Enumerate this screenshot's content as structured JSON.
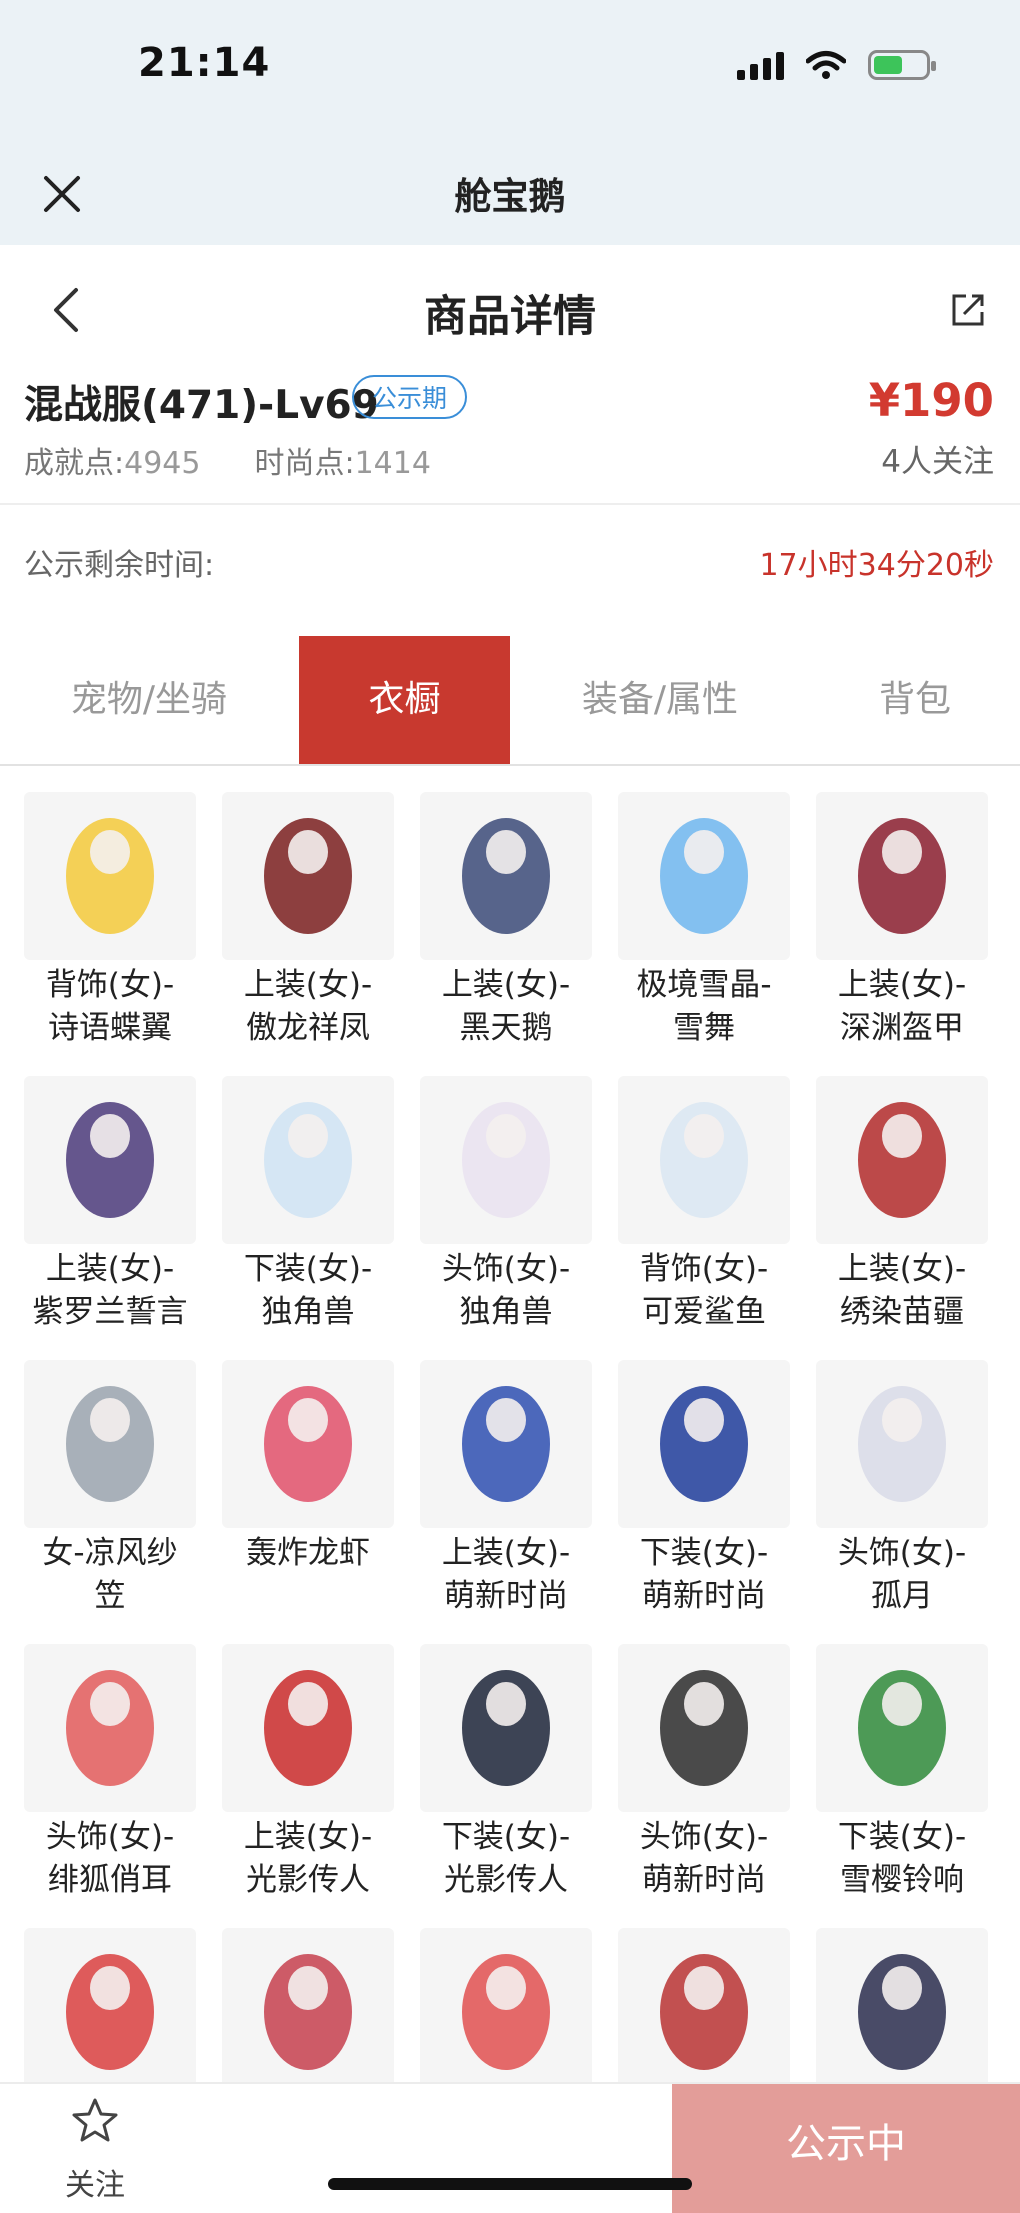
{
  "status_bar": {
    "time": "21:14"
  },
  "app_bar": {
    "title": "舱宝鹅"
  },
  "page_header": {
    "title": "商品详情"
  },
  "product": {
    "name": "混战服(471)-Lv69",
    "badge": "公示期",
    "price": "¥190",
    "achievement_label": "成就点:",
    "achievement_value": "4945",
    "fashion_label": "时尚点:",
    "fashion_value": "1414",
    "followers": "4人关注"
  },
  "countdown": {
    "label": "公示剩余时间:",
    "value": "17小时34分20秒"
  },
  "tabs": [
    {
      "label": "宠物/坐骑",
      "active": false
    },
    {
      "label": "衣橱",
      "active": true
    },
    {
      "label": "装备/属性",
      "active": false
    },
    {
      "label": "背包",
      "active": false
    }
  ],
  "wardrobe_items": [
    {
      "line1": "背饰(女)-",
      "line2": "诗语蝶翼"
    },
    {
      "line1": "上装(女)-",
      "line2": "傲龙祥凤"
    },
    {
      "line1": "上装(女)-",
      "line2": "黑天鹅"
    },
    {
      "line1": "极境雪晶-",
      "line2": "雪舞"
    },
    {
      "line1": "上装(女)-",
      "line2": "深渊盔甲"
    },
    {
      "line1": "上装(女)-",
      "line2": "紫罗兰誓言"
    },
    {
      "line1": "下装(女)-",
      "line2": "独角兽"
    },
    {
      "line1": "头饰(女)-",
      "line2": "独角兽"
    },
    {
      "line1": "背饰(女)-",
      "line2": "可爱鲨鱼"
    },
    {
      "line1": "上装(女)-",
      "line2": "绣染苗疆"
    },
    {
      "line1": "女-凉风纱",
      "line2": "笠"
    },
    {
      "line1": "轰炸龙虾",
      "line2": ""
    },
    {
      "line1": "上装(女)-",
      "line2": "萌新时尚"
    },
    {
      "line1": "下装(女)-",
      "line2": "萌新时尚"
    },
    {
      "line1": "头饰(女)-",
      "line2": "孤月"
    },
    {
      "line1": "头饰(女)-",
      "line2": "绯狐俏耳"
    },
    {
      "line1": "上装(女)-",
      "line2": "光影传人"
    },
    {
      "line1": "下装(女)-",
      "line2": "光影传人"
    },
    {
      "line1": "头饰(女)-",
      "line2": "萌新时尚"
    },
    {
      "line1": "下装(女)-",
      "line2": "雪樱铃响"
    },
    {
      "line1": "",
      "line2": ""
    },
    {
      "line1": "",
      "line2": ""
    },
    {
      "line1": "",
      "line2": ""
    },
    {
      "line1": "",
      "line2": ""
    },
    {
      "line1": "",
      "line2": ""
    }
  ],
  "bottom_bar": {
    "follow_label": "关注",
    "status_button": "公示中"
  },
  "colors": {
    "accent_red": "#c8392f",
    "price_red": "#d23a30",
    "badge_blue": "#3a8ed8",
    "button_pink": "#e39d99"
  }
}
